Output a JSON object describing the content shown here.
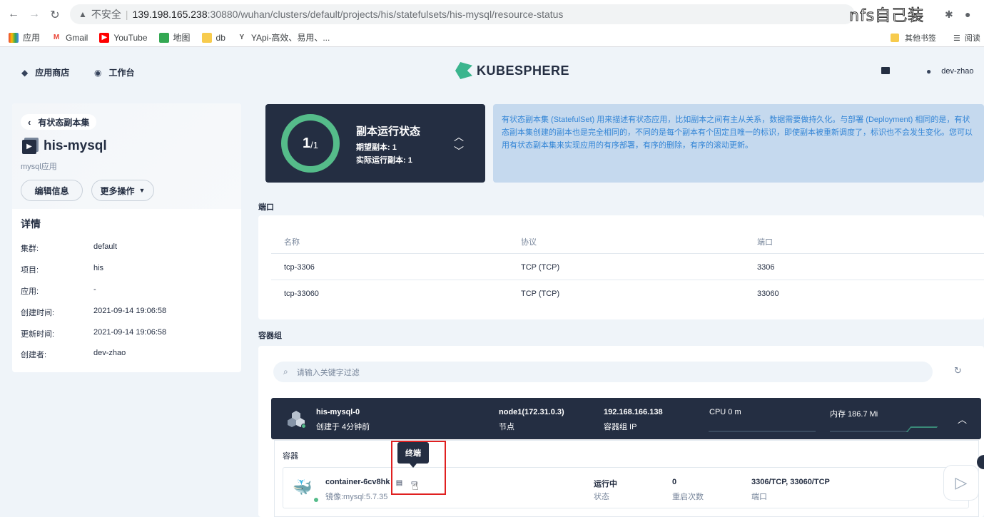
{
  "browser": {
    "insecure_label": "不安全",
    "url_host": "139.198.165.238",
    "url_path": ":30880/wuhan/clusters/default/projects/his/statefulsets/his-mysql/resource-status",
    "overlay_text": "nfs自己装",
    "bookmarks": [
      "应用",
      "Gmail",
      "YouTube",
      "地图",
      "db",
      "YApi-高效、易用、..."
    ],
    "bookmarks_right": [
      "其他书签",
      "阅读"
    ]
  },
  "header": {
    "app_store": "应用商店",
    "workbench": "工作台",
    "logo_text": "KUBESPHERE",
    "user": "dev-zhao"
  },
  "left": {
    "back_label": "有状态副本集",
    "title": "his-mysql",
    "subtitle": "mysql应用",
    "edit_button": "编辑信息",
    "more_button": "更多操作",
    "details_title": "详情",
    "details": [
      {
        "key": "集群:",
        "value": "default"
      },
      {
        "key": "项目:",
        "value": "his"
      },
      {
        "key": "应用:",
        "value": "-"
      },
      {
        "key": "创建时间:",
        "value": "2021-09-14 19:06:58"
      },
      {
        "key": "更新时间:",
        "value": "2021-09-14 19:06:58"
      },
      {
        "key": "创建者:",
        "value": "dev-zhao"
      }
    ]
  },
  "status": {
    "current": "1",
    "total": "/1",
    "title": "副本运行状态",
    "desired": "期望副本: 1",
    "running": "实际运行副本: 1"
  },
  "info_text": "有状态副本集 (StatefulSet) 用来描述有状态应用，比如副本之间有主从关系，数据需要做持久化。与部署 (Deployment) 相同的是，有状态副本集创建的副本也是完全相同的，不同的是每个副本有个固定且唯一的标识，即使副本被重新调度了，标识也不会发生变化。您可以用有状态副本集来实现应用的有序部署，有序的删除，有序的滚动更新。",
  "ports": {
    "section": "端口",
    "headers": [
      "名称",
      "协议",
      "端口"
    ],
    "rows": [
      [
        "tcp-3306",
        "TCP (TCP)",
        "3306"
      ],
      [
        "tcp-33060",
        "TCP (TCP)",
        "33060"
      ]
    ]
  },
  "pods": {
    "section": "容器组",
    "search_placeholder": "请输入关键字过滤",
    "pod": {
      "name": "his-mysql-0",
      "created": "创建于 4分钟前",
      "node": "node1(172.31.0.3)",
      "node_label": "节点",
      "ip": "192.168.166.138",
      "ip_label": "容器组 IP",
      "cpu": "CPU 0 m",
      "memory": "内存 186.7 Mi"
    },
    "containers_label": "容器",
    "container": {
      "name": "container-6cv8hk",
      "image": "镜像:mysql:5.7.35",
      "status": "运行中",
      "status_label": "状态",
      "restarts": "0",
      "restarts_label": "重启次数",
      "ports": "3306/TCP, 33060/TCP",
      "ports_label": "端口"
    },
    "tooltip": "终端"
  },
  "colors": {
    "dark": "#242e42",
    "green": "#55bc8a",
    "info_bg": "#c5d9ee",
    "info_text": "#3385d6",
    "highlight": "#e02020"
  }
}
